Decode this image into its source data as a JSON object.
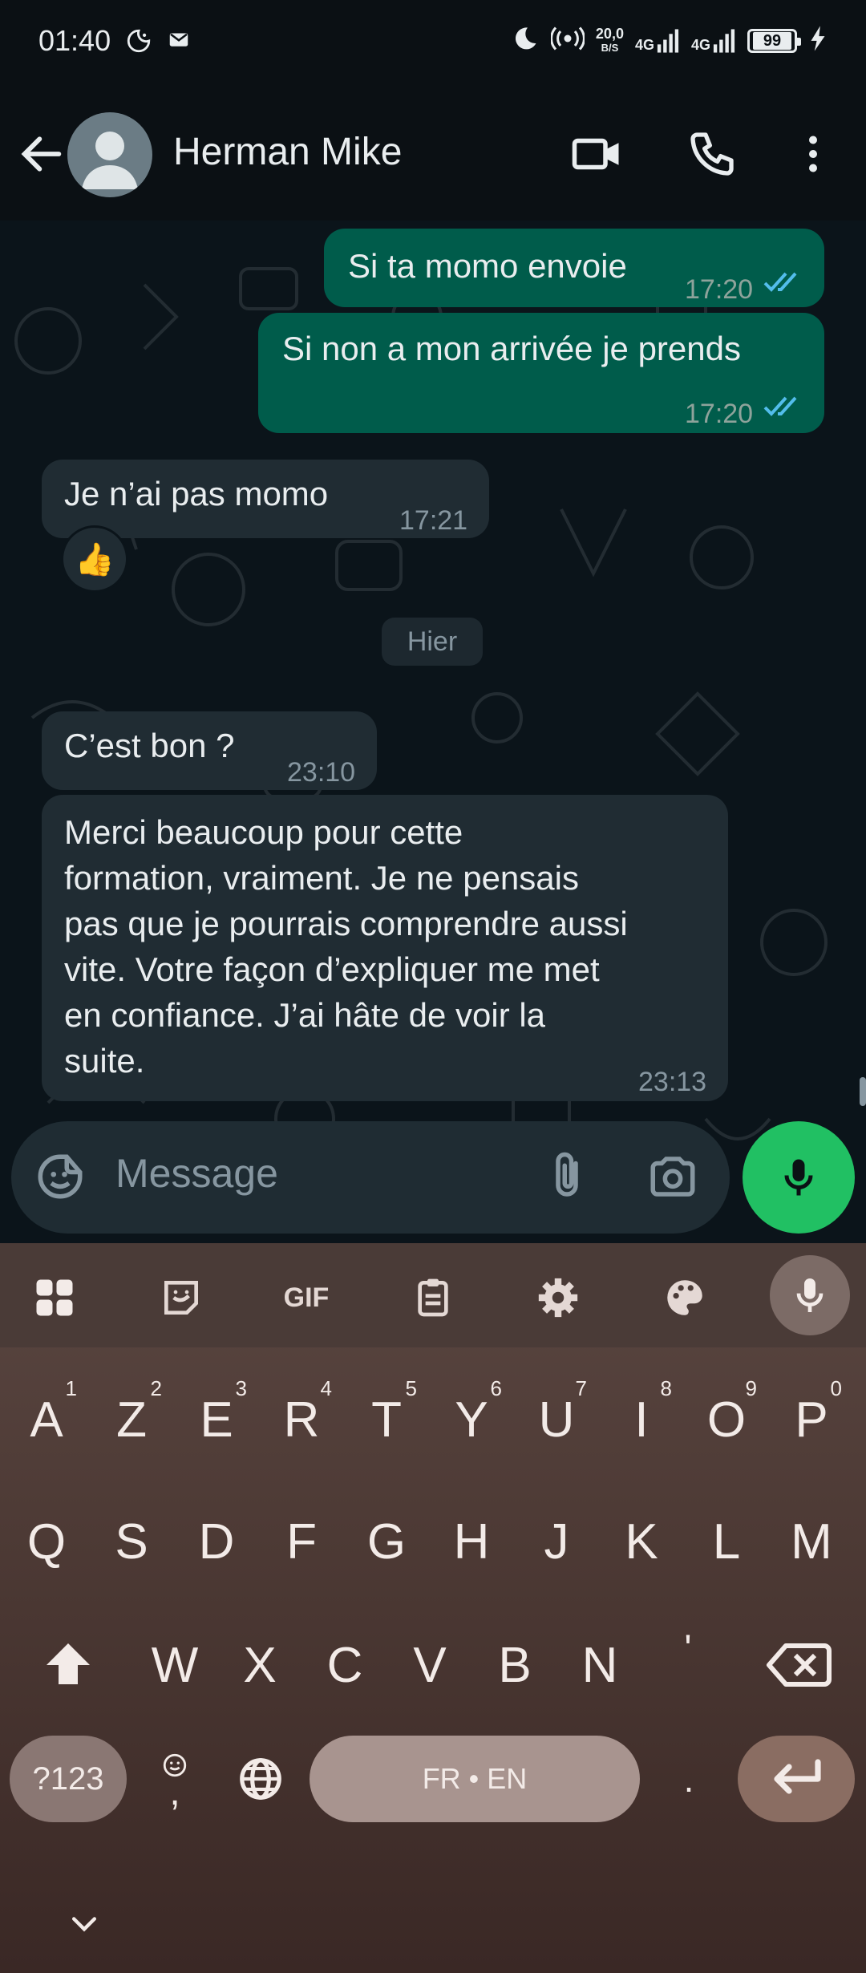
{
  "status_bar": {
    "time": "01:40",
    "net_speed_value": "20,0",
    "net_speed_unit": "B/S",
    "network_1": "4G",
    "network_2": "4G",
    "battery": "99"
  },
  "header": {
    "contact_name": "Herman Mike",
    "icons": [
      "back-arrow-icon",
      "avatar",
      "video-call-icon",
      "phone-icon",
      "more-vert-icon"
    ]
  },
  "messages": [
    {
      "direction": "out",
      "text": "Si ta momo envoie",
      "time": "17:20",
      "status": "read"
    },
    {
      "direction": "out",
      "text": "Si non a mon arrivée je prends",
      "time": "17:20",
      "status": "read"
    },
    {
      "direction": "in",
      "text": "Je n’ai pas momo",
      "time": "17:21",
      "reaction": "👍"
    },
    {
      "direction": "in",
      "text": "C’est bon ?",
      "time": "23:10"
    },
    {
      "direction": "in",
      "text_lines": [
        "Merci beaucoup pour cette",
        "formation, vraiment. Je ne pensais",
        "pas que je pourrais comprendre aussi",
        "vite. Votre façon d’expliquer me met",
        "en confiance. J’ai hâte de voir la",
        "suite."
      ],
      "time": "23:13"
    }
  ],
  "date_divider": "Hier",
  "composer": {
    "placeholder": "Message"
  },
  "keyboard": {
    "toolbar": {
      "gif_label": "GIF"
    },
    "row1": [
      {
        "k": "A",
        "s": "1"
      },
      {
        "k": "Z",
        "s": "2"
      },
      {
        "k": "E",
        "s": "3"
      },
      {
        "k": "R",
        "s": "4"
      },
      {
        "k": "T",
        "s": "5"
      },
      {
        "k": "Y",
        "s": "6"
      },
      {
        "k": "U",
        "s": "7"
      },
      {
        "k": "I",
        "s": "8"
      },
      {
        "k": "O",
        "s": "9"
      },
      {
        "k": "P",
        "s": "0"
      }
    ],
    "row2": [
      "Q",
      "S",
      "D",
      "F",
      "G",
      "H",
      "J",
      "K",
      "L",
      "M"
    ],
    "row3": [
      "W",
      "X",
      "C",
      "V",
      "B",
      "N",
      "'"
    ],
    "symbols_key": "?123",
    "emoji_comma_key": ",",
    "space_label": "FR • EN",
    "period_key": "."
  },
  "colors": {
    "outgoing_bubble": "#005c4b",
    "incoming_bubble": "#202c33",
    "accent_green": "#21c063",
    "read_ticks": "#53bdeb"
  }
}
